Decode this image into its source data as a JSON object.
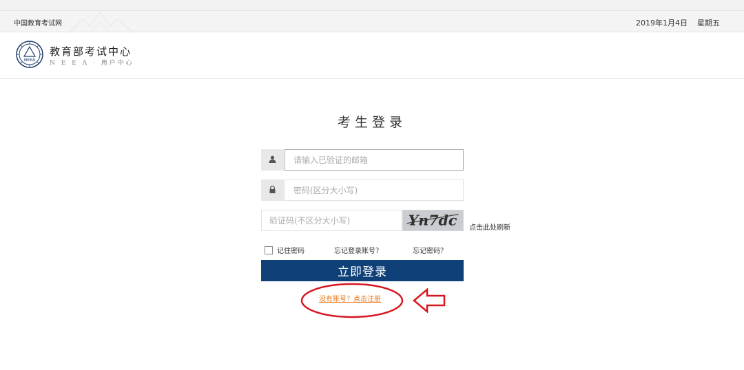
{
  "topbar": {
    "site_name": "中国教育考试网",
    "date": "2019年1月4日",
    "weekday": "星期五"
  },
  "brand": {
    "title": "教育部考试中心",
    "subtitle": "N E E A · 用户中心",
    "logo_text": "NEEA"
  },
  "login": {
    "title": "考生登录",
    "email_placeholder": "请输入已验证的邮箱",
    "password_placeholder": "密码(区分大小写)",
    "captcha_placeholder": "验证码(不区分大小写)",
    "captcha_text": "Yn7dc",
    "refresh_label": "点击此处刷新",
    "remember_label": "记住密码",
    "forgot_account": "忘记登录账号？",
    "forgot_password": "忘记密码？",
    "submit_label": "立即登录",
    "register_link": "没有账号？点击注册"
  },
  "colors": {
    "button": "#0f4078",
    "register_link": "#e8761a",
    "annotation": "#d8161f"
  },
  "icons": [
    "user-icon",
    "lock-icon"
  ]
}
